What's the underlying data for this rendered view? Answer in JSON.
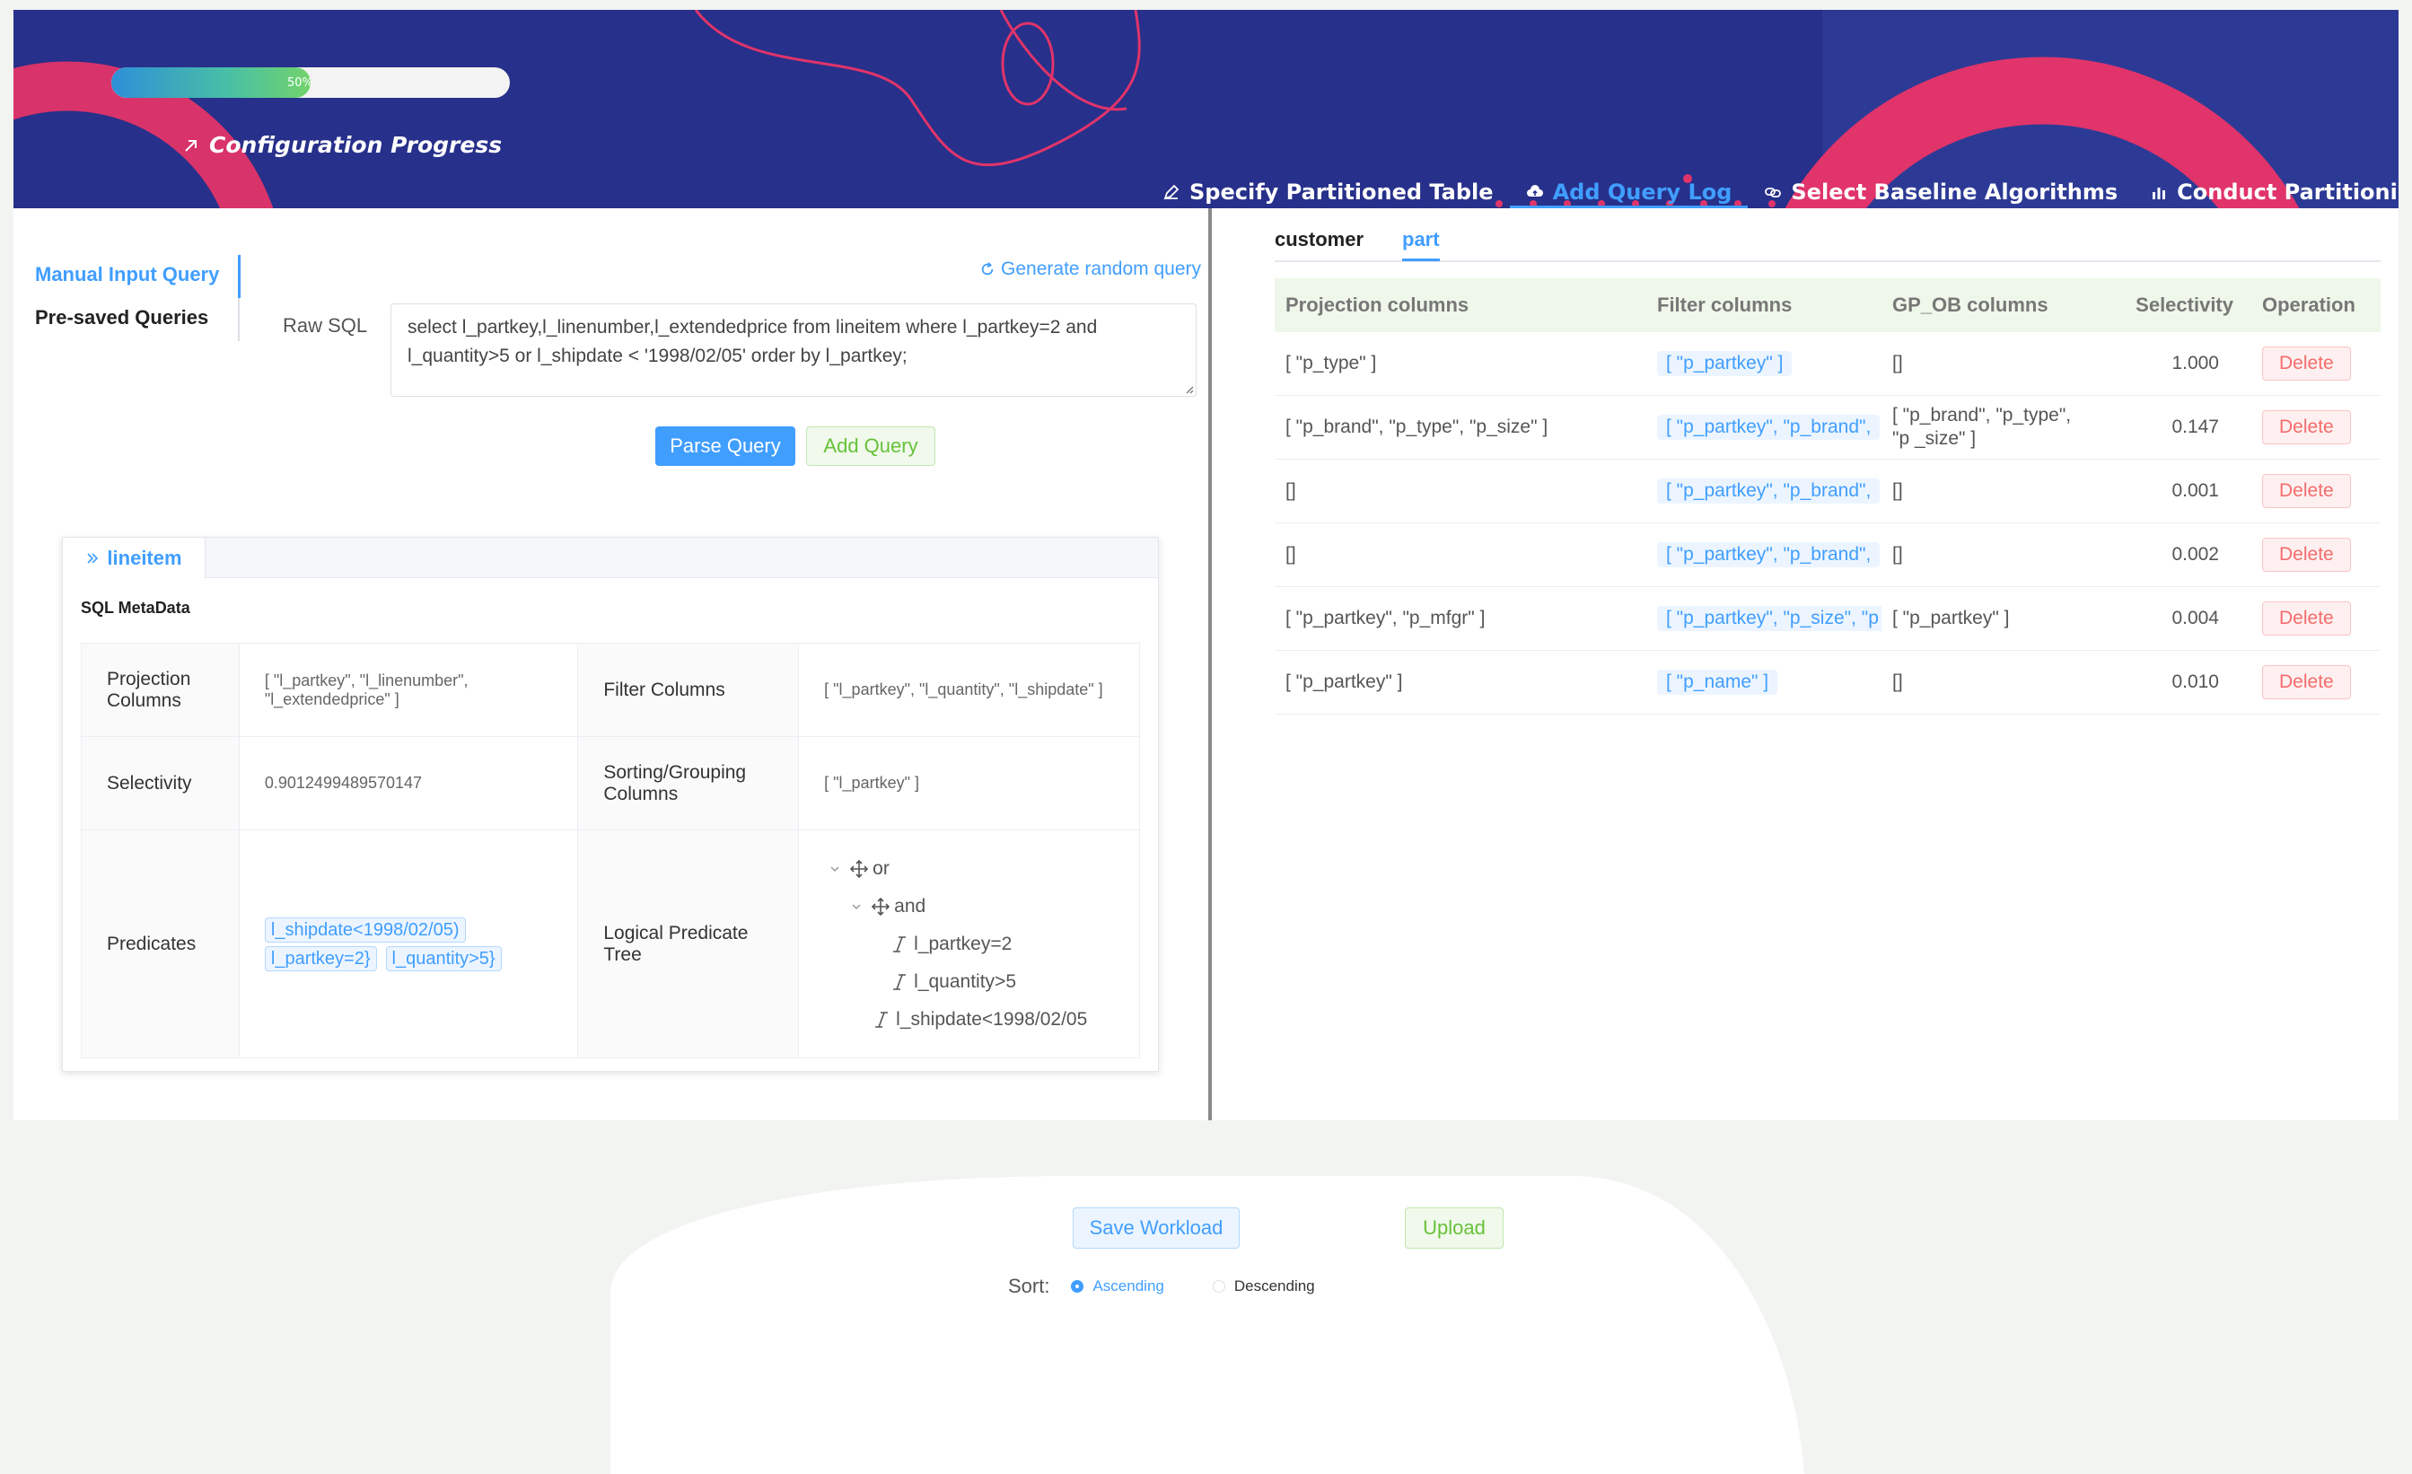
{
  "header": {
    "progress_percent": 50,
    "progress_text": "50%",
    "progress_label": "Configuration Progress",
    "steps": [
      {
        "label": "Specify Partitioned Table",
        "icon": "edit-icon",
        "active": false
      },
      {
        "label": "Add Query Log",
        "icon": "upload-cloud-icon",
        "active": true
      },
      {
        "label": "Select Baseline Algorithms",
        "icon": "link-icon",
        "active": false
      },
      {
        "label": "Conduct Partitioning Decision",
        "icon": "bar-chart-icon",
        "active": false
      }
    ]
  },
  "left": {
    "tabs": [
      "Manual Input Query",
      "Pre-saved Queries"
    ],
    "generate_link": "Generate random query",
    "raw_sql_label": "Raw SQL",
    "raw_sql": "select l_partkey,l_linenumber,l_extendedprice from lineitem where l_partkey=2 and l_quantity>5 or l_shipdate < '1998/02/05' order by l_partkey;",
    "parse_button": "Parse Query",
    "add_button": "Add Query",
    "card": {
      "tab": "lineitem",
      "title": "SQL MetaData",
      "projection_label": "Projection Columns",
      "projection_value": "[ \"l_partkey\", \"l_linenumber\", \"l_extendedprice\" ]",
      "filter_label": "Filter Columns",
      "filter_value": "[ \"l_partkey\", \"l_quantity\", \"l_shipdate\" ]",
      "selectivity_label": "Selectivity",
      "selectivity_value": "0.9012499489570147",
      "sorting_label": "Sorting/Grouping Columns",
      "sorting_value": "[ \"l_partkey\" ]",
      "predicates_label": "Predicates",
      "predicates": [
        "l_shipdate<1998/02/05)",
        "l_partkey=2}",
        "l_quantity>5}"
      ],
      "tree_label": "Logical Predicate Tree",
      "tree": {
        "or": "or",
        "and": "and",
        "leaf1": "l_partkey=2",
        "leaf2": "l_quantity>5",
        "leaf3": "l_shipdate<1998/02/05"
      }
    }
  },
  "right": {
    "tabs": [
      "customer",
      "part"
    ],
    "active_tab": "part",
    "columns": [
      "Projection columns",
      "Filter columns",
      "GP_OB columns",
      "Selectivity",
      "Operation"
    ],
    "rows": [
      {
        "projection": "[ \"p_type\" ]",
        "filter": "[ \"p_partkey\" ]",
        "gpob": "[]",
        "selectivity": "1.000",
        "op": "Delete"
      },
      {
        "projection": "[ \"p_brand\", \"p_type\", \"p_size\" ]",
        "filter": "[ \"p_partkey\", \"p_brand\",",
        "gpob": "[ \"p_brand\", \"p_type\", \"p _size\" ]",
        "selectivity": "0.147",
        "op": "Delete"
      },
      {
        "projection": "[]",
        "filter": "[ \"p_partkey\", \"p_brand\",",
        "gpob": "[]",
        "selectivity": "0.001",
        "op": "Delete"
      },
      {
        "projection": "[]",
        "filter": "[ \"p_partkey\", \"p_brand\",",
        "gpob": "[]",
        "selectivity": "0.002",
        "op": "Delete"
      },
      {
        "projection": "[ \"p_partkey\", \"p_mfgr\" ]",
        "filter": "[ \"p_partkey\", \"p_size\", \"p",
        "gpob": "[ \"p_partkey\" ]",
        "selectivity": "0.004",
        "op": "Delete"
      },
      {
        "projection": "[ \"p_partkey\" ]",
        "filter": "[ \"p_name\" ]",
        "gpob": "[]",
        "selectivity": "0.010",
        "op": "Delete"
      }
    ]
  },
  "bottom": {
    "save_button": "Save Workload",
    "upload_button": "Upload",
    "sort_label": "Sort:",
    "sort_options": [
      "Ascending",
      "Descending"
    ],
    "sort_selected": "Ascending"
  },
  "colors": {
    "header_bg": "#27308a",
    "accent": "#409eff",
    "success": "#67c23a",
    "danger": "#f56c6c",
    "deco_pink": "#e0346a"
  }
}
